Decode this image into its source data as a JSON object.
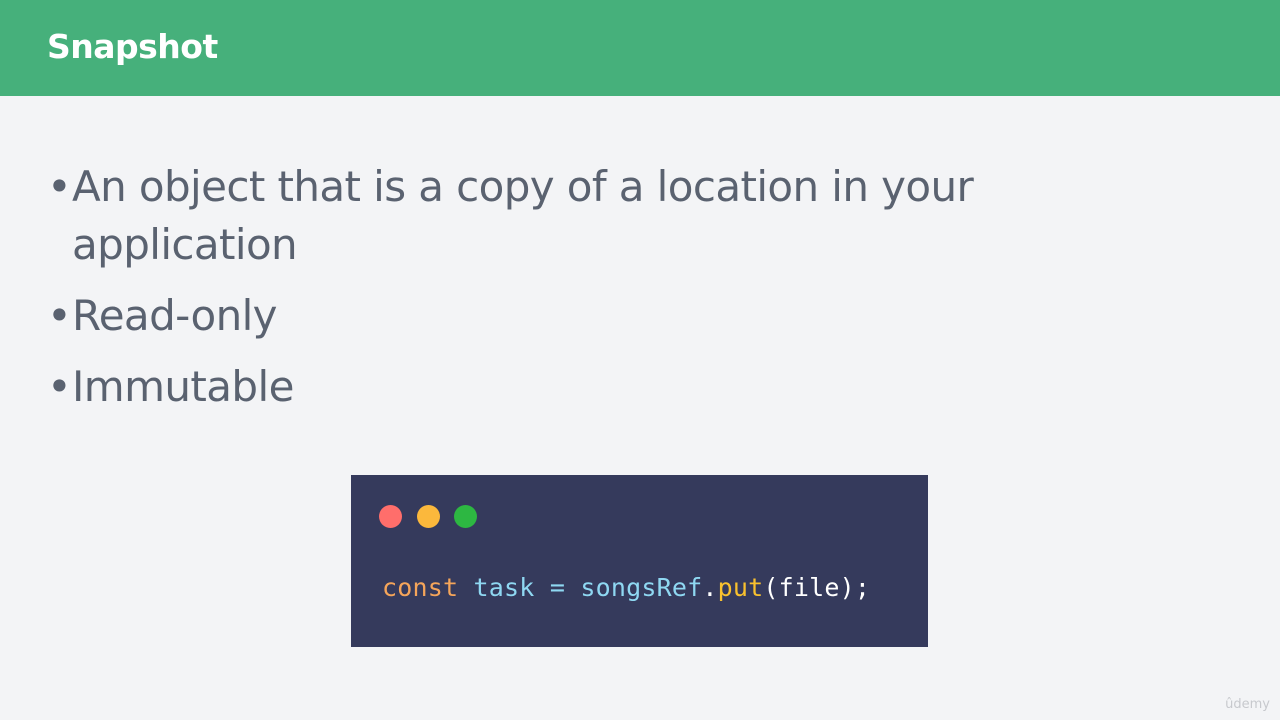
{
  "header": {
    "title": "Snapshot",
    "background_color": "#46b07b"
  },
  "bullets": [
    {
      "text": "An object that is a copy of a location in your application"
    },
    {
      "text": "Read-only"
    },
    {
      "text": "Immutable"
    }
  ],
  "code_window": {
    "background_color": "#353a5c",
    "traffic_lights": [
      {
        "name": "close",
        "color": "#ff6e6b"
      },
      {
        "name": "minimize",
        "color": "#fbb83c"
      },
      {
        "name": "maximize",
        "color": "#2db742"
      }
    ],
    "code": {
      "keyword": "const",
      "variable": "task",
      "operator": "=",
      "object": "songsRef",
      "dot": ".",
      "method": "put",
      "args": "(file);"
    }
  },
  "watermark": "ûdemy"
}
